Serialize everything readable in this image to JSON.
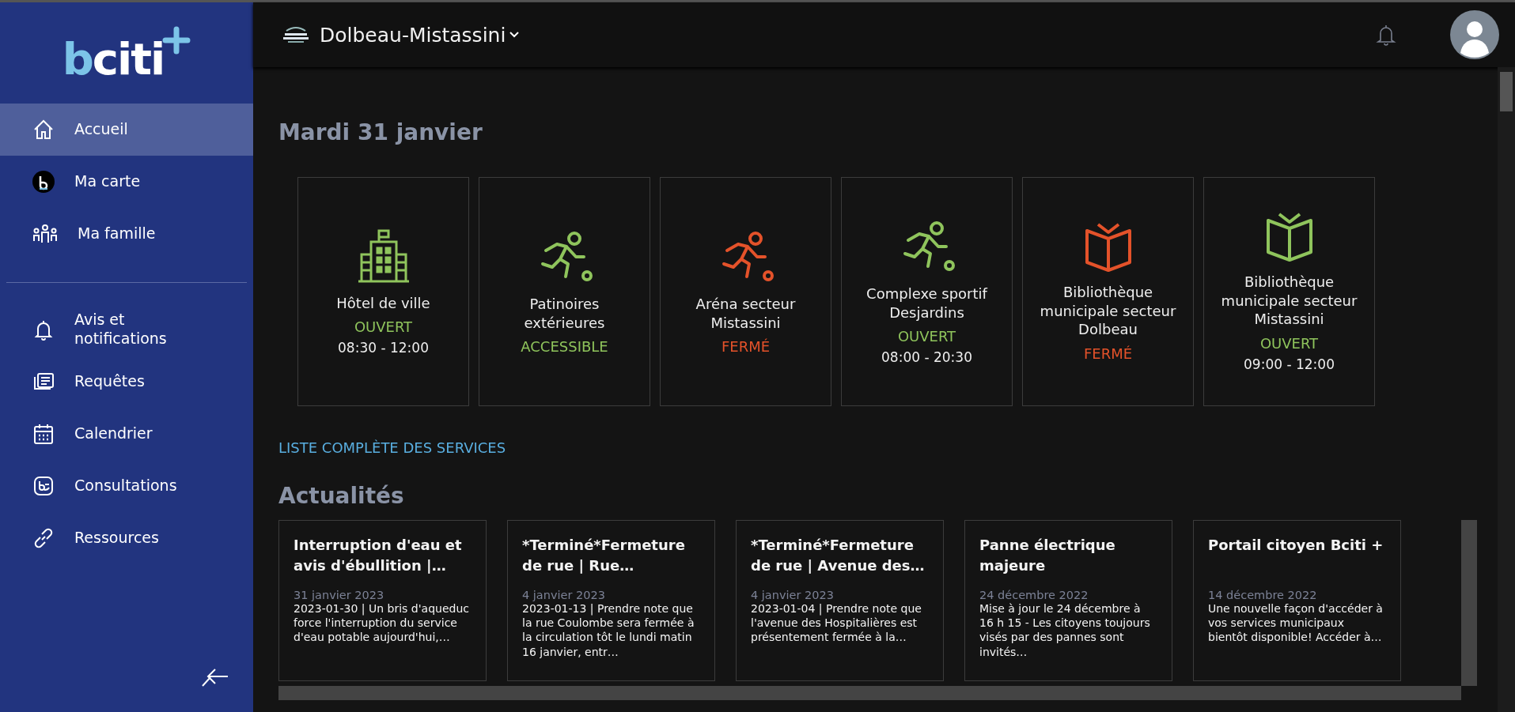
{
  "logo": {
    "text": "bciti"
  },
  "nav_groups": [
    [
      {
        "label": "Accueil",
        "kind": "home",
        "selected": true
      },
      {
        "label": "Ma carte",
        "kind": "card",
        "selected": false
      },
      {
        "label": "Ma famille",
        "kind": "family",
        "selected": false
      }
    ],
    [
      {
        "label": "Avis et notifications",
        "kind": "bell",
        "selected": false
      },
      {
        "label": "Requêtes",
        "kind": "requests",
        "selected": false
      },
      {
        "label": "Calendrier",
        "kind": "calendar",
        "selected": false
      },
      {
        "label": "Consultations",
        "kind": "consult",
        "selected": false
      },
      {
        "label": "Ressources",
        "kind": "link",
        "selected": false
      }
    ]
  ],
  "header": {
    "city": "Dolbeau-Mistassini"
  },
  "date_title": "Mardi 31 janvier",
  "services": [
    {
      "name": "Hôtel de ville",
      "kind": "building",
      "color": "#8fc45c",
      "status": "OUVERT",
      "hours": "08:30 - 12:00"
    },
    {
      "name": "Patinoires extérieures",
      "kind": "sport",
      "color": "#8fc45c",
      "status": "ACCESSIBLE"
    },
    {
      "name": "Aréna secteur Mistassini",
      "kind": "sport",
      "color": "#e4522a",
      "status": "FERMÉ"
    },
    {
      "name": "Complexe sportif Desjardins",
      "kind": "sport",
      "color": "#8fc45c",
      "status": "OUVERT",
      "hours": "08:00 - 20:30"
    },
    {
      "name": "Bibliothèque municipale secteur Dolbeau",
      "kind": "book",
      "color": "#e4522a",
      "status": "FERMÉ"
    },
    {
      "name": "Bibliothèque municipale secteur Mistassini",
      "kind": "book",
      "color": "#8fc45c",
      "status": "OUVERT",
      "hours": "09:00 - 12:00"
    }
  ],
  "services_link": "LISTE COMPLÈTE DES SERVICES",
  "news_title": "Actualités",
  "news": [
    {
      "title": "Interruption d'eau et avis d'ébullition |…",
      "date": "31 janvier 2023",
      "excerpt": "2023-01-30 | Un bris d'aqueduc force l'interruption du service d'eau potable aujourd'hui,…"
    },
    {
      "title": "*Terminé*Fermeture de rue | Rue…",
      "date": "4 janvier 2023",
      "excerpt": "2023-01-13 | Prendre note que la rue Coulombe sera fermée à la circulation tôt le lundi matin 16 janvier, entr…"
    },
    {
      "title": "*Terminé*Fermeture de rue | Avenue des…",
      "date": "4 janvier 2023",
      "excerpt": "2023-01-04 | Prendre note que l'avenue des Hospitalières est présentement fermée à la…"
    },
    {
      "title": "Panne électrique majeure",
      "date": "24 décembre 2022",
      "excerpt": "Mise à jour le 24 décembre à 16 h 15 - Les citoyens toujours visés par des pannes sont invités…"
    },
    {
      "title": "Portail citoyen Bciti +",
      "date": "14 décembre 2022",
      "excerpt": "Une nouvelle façon d'accéder à vos services municipaux bientôt disponible! Accéder à…"
    }
  ]
}
